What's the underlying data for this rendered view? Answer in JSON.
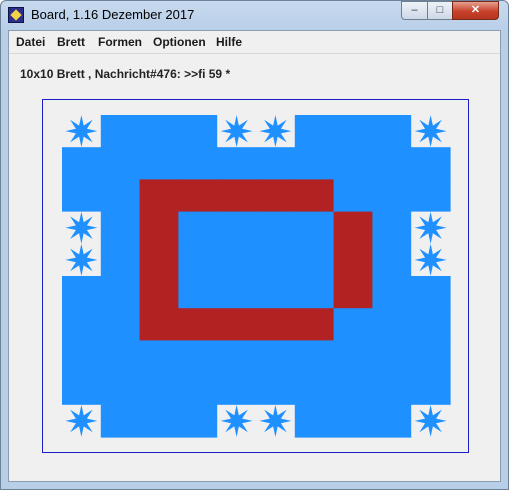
{
  "window": {
    "title": "Board, 1.16 Dezember 2017",
    "controls": {
      "minimize": "–",
      "maximize": "□",
      "close": "✕"
    }
  },
  "menu": {
    "items": [
      "Datei",
      "Brett",
      "Formen",
      "Optionen",
      "Hilfe"
    ]
  },
  "status": {
    "text": "10x10 Brett , Nachricht#476: >>fi 59 *"
  },
  "board": {
    "rows": 10,
    "cols": 10,
    "colors": {
      "cell": "#1e90ff",
      "star": "#1e90ff",
      "star_bg": "#f0f0f0",
      "red": "#b22222",
      "frame": "#1d1dc8"
    },
    "stars": [
      [
        0,
        0
      ],
      [
        0,
        4
      ],
      [
        0,
        5
      ],
      [
        0,
        9
      ],
      [
        3,
        0
      ],
      [
        4,
        0
      ],
      [
        3,
        9
      ],
      [
        4,
        9
      ],
      [
        9,
        0
      ],
      [
        9,
        4
      ],
      [
        9,
        5
      ],
      [
        9,
        9
      ]
    ],
    "red_cells": [
      [
        2,
        2
      ],
      [
        2,
        3
      ],
      [
        2,
        4
      ],
      [
        2,
        5
      ],
      [
        2,
        6
      ],
      [
        3,
        2
      ],
      [
        3,
        7
      ],
      [
        4,
        2
      ],
      [
        4,
        7
      ],
      [
        5,
        2
      ],
      [
        5,
        7
      ],
      [
        6,
        2
      ],
      [
        6,
        3
      ],
      [
        6,
        4
      ],
      [
        6,
        5
      ],
      [
        6,
        6
      ]
    ],
    "hidden_cells": [
      [
        1,
        0
      ],
      [
        2,
        0
      ],
      [
        5,
        0
      ],
      [
        6,
        0
      ],
      [
        7,
        0
      ],
      [
        8,
        0
      ],
      [
        1,
        9
      ],
      [
        2,
        9
      ],
      [
        5,
        9
      ],
      [
        6,
        9
      ],
      [
        7,
        9
      ],
      [
        8,
        9
      ]
    ]
  }
}
